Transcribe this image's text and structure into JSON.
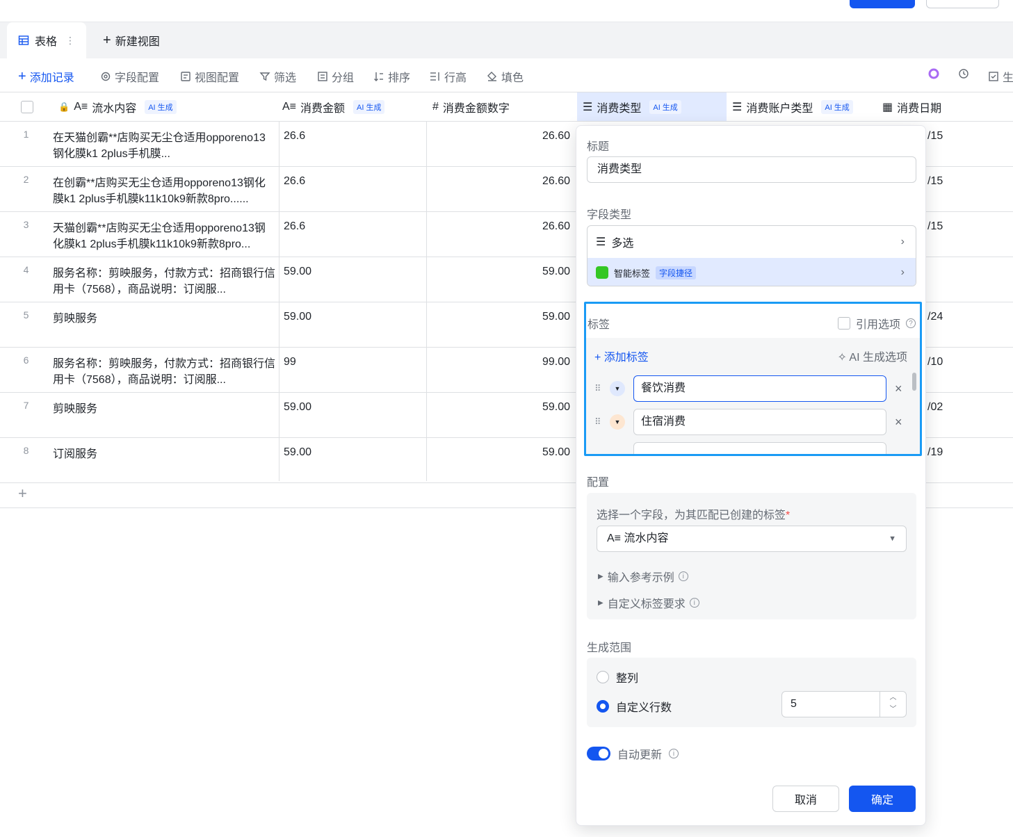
{
  "tabs": {
    "active": "表格",
    "new_view": "新建视图"
  },
  "toolbar": {
    "add_record": "添加记录",
    "field_config": "字段配置",
    "view_config": "视图配置",
    "filter": "筛选",
    "group": "分组",
    "sort": "排序",
    "row_height": "行高",
    "fill_color": "填色",
    "gen_partial": "生"
  },
  "columns": [
    {
      "name": "流水内容",
      "ai": "AI 生成"
    },
    {
      "name": "消费金额",
      "ai": "AI 生成"
    },
    {
      "name": "消费金额数字",
      "ai": ""
    },
    {
      "name": "消费类型",
      "ai": "AI 生成"
    },
    {
      "name": "消费账户类型",
      "ai": "AI 生成"
    },
    {
      "name": "消费日期",
      "ai": ""
    }
  ],
  "rows": [
    {
      "n": "1",
      "content": "在天猫创霸**店购买无尘仓适用opporeno13钢化膜k1 2plus手机膜...",
      "amount": "26.6",
      "amount_num": "26.60",
      "date": "/15"
    },
    {
      "n": "2",
      "content": "在创霸**店购买无尘仓适用opporeno13钢化膜k1 2plus手机膜k11k10k9新款8pro......",
      "amount": "26.6",
      "amount_num": "26.60",
      "date": "/15"
    },
    {
      "n": "3",
      "content": "天猫创霸**店购买无尘仓适用opporeno13钢化膜k1 2plus手机膜k11k10k9新款8pro...",
      "amount": "26.6",
      "amount_num": "26.60",
      "date": "/15"
    },
    {
      "n": "4",
      "content": "服务名称：剪映服务，付款方式：招商银行信用卡（7568），商品说明：订阅服...",
      "amount": "59.00",
      "amount_num": "59.00",
      "date": ""
    },
    {
      "n": "5",
      "content": "剪映服务",
      "amount": "59.00",
      "amount_num": "59.00",
      "date": "/24"
    },
    {
      "n": "6",
      "content": "服务名称：剪映服务，付款方式：招商银行信用卡（7568），商品说明：订阅服...",
      "amount": "99",
      "amount_num": "99.00",
      "date": "/10"
    },
    {
      "n": "7",
      "content": "剪映服务",
      "amount": "59.00",
      "amount_num": "59.00",
      "date": "/02"
    },
    {
      "n": "8",
      "content": "订阅服务",
      "amount": "59.00",
      "amount_num": "59.00",
      "date": "/19"
    }
  ],
  "add_row": "+",
  "panel": {
    "title_label": "标题",
    "title_value": "消费类型",
    "field_type_label": "字段类型",
    "field_type_value": "多选",
    "smart_tag": "智能标签",
    "smart_tag_badge": "字段捷径",
    "tags_label": "标签",
    "ref_option": "引用选项",
    "add_tag": "+ 添加标签",
    "ai_gen_option": "AI 生成选项",
    "tags": [
      {
        "label": "餐饮消费",
        "color": "#dfe8fd"
      },
      {
        "label": "住宿消费",
        "color": "#fde6d1"
      }
    ],
    "config_label": "配置",
    "config_prompt": "选择一个字段，为其匹配已创建的标签",
    "config_required": "*",
    "config_field": "流水内容",
    "ref_example": "输入参考示例",
    "custom_req": "自定义标签要求",
    "range_label": "生成范围",
    "range_full": "整列",
    "range_custom": "自定义行数",
    "range_rows": "5",
    "auto_update": "自动更新",
    "cancel": "取消",
    "confirm": "确定"
  }
}
